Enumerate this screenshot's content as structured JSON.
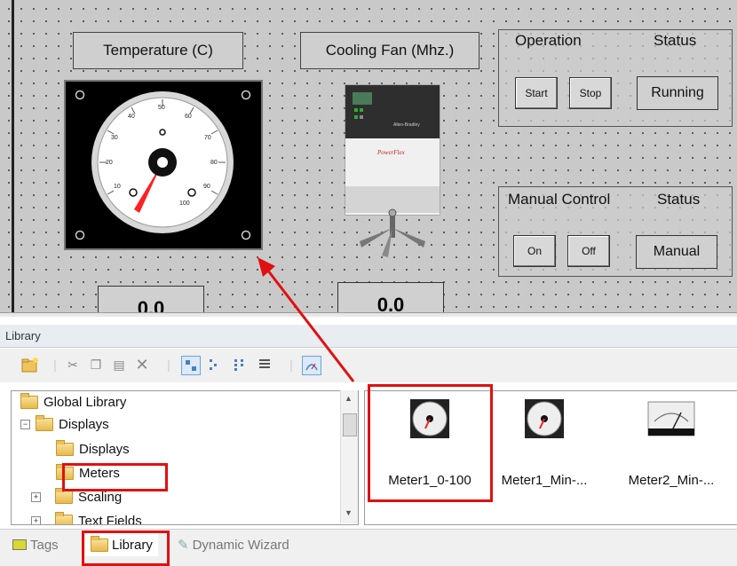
{
  "canvas": {
    "temperature_label": "Temperature (C)",
    "fan_label": "Cooling Fan (Mhz.)",
    "operation": {
      "title": "Operation",
      "status_title": "Status",
      "start": "Start",
      "stop": "Stop",
      "status_value": "Running"
    },
    "manual": {
      "title": "Manual Control",
      "status_title": "Status",
      "on": "On",
      "off": "Off",
      "status_value": "Manual"
    },
    "temp_value": "0.0",
    "fan_value": "0.0",
    "gauge_ticks": [
      "10",
      "20",
      "30",
      "40",
      "50",
      "60",
      "70",
      "80",
      "90",
      "100"
    ]
  },
  "library": {
    "header": "Library",
    "tree": {
      "global_library": "Global Library",
      "displays": "Displays",
      "displays_child": "Displays",
      "meters": "Meters",
      "scaling": "Scaling",
      "text_fields": "Text Fields"
    },
    "items": [
      {
        "label": "Meter1_0-100",
        "icon": "round-meter-icon"
      },
      {
        "label": "Meter1_Min-...",
        "icon": "round-meter-icon"
      },
      {
        "label": "Meter2_Min-...",
        "icon": "panel-meter-icon"
      }
    ]
  },
  "tabs": {
    "tags": "Tags",
    "library": "Library",
    "dynamic_wizard": "Dynamic Wizard"
  },
  "colors": {
    "highlight": "#e01010",
    "canvas": "#c9c9c9"
  }
}
